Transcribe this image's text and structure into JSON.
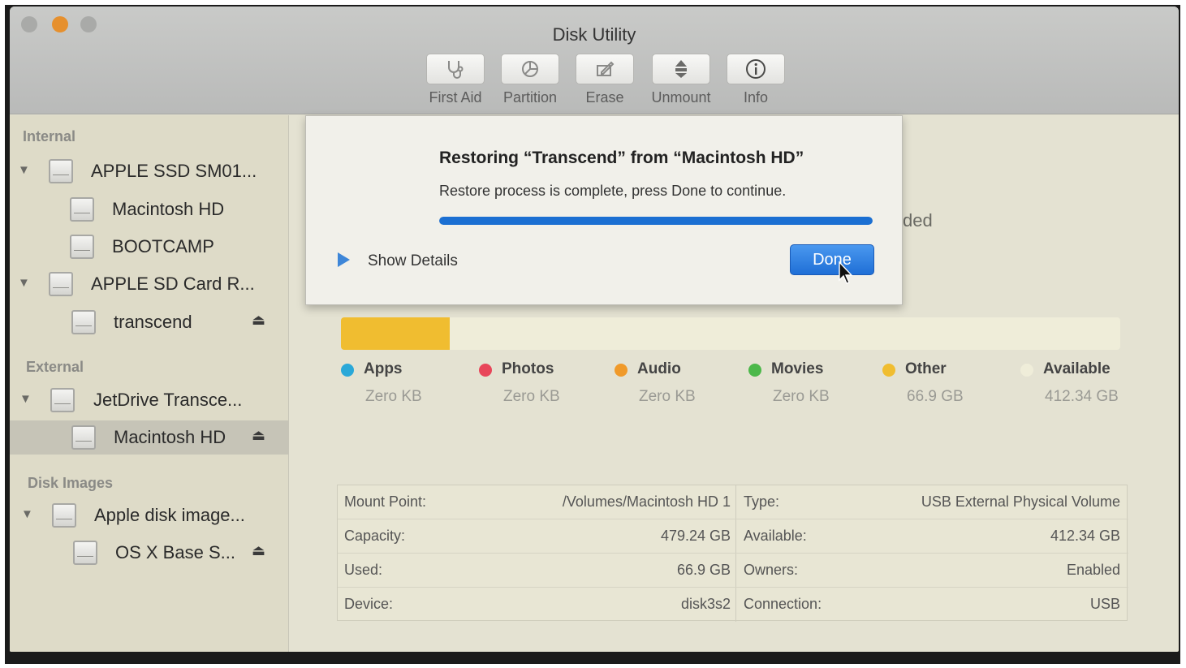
{
  "window": {
    "title": "Disk Utility"
  },
  "toolbar": {
    "items": [
      {
        "label": "First Aid",
        "icon": "stethoscope-icon"
      },
      {
        "label": "Partition",
        "icon": "partition-pie-icon"
      },
      {
        "label": "Erase",
        "icon": "erase-icon"
      },
      {
        "label": "Unmount",
        "icon": "unmount-icon"
      },
      {
        "label": "Info",
        "icon": "info-icon"
      }
    ]
  },
  "sidebar": {
    "sections": {
      "internal": "Internal",
      "external": "External",
      "disk_images": "Disk Images"
    },
    "items": [
      {
        "label": "APPLE SSD SM01..."
      },
      {
        "label": "Macintosh HD"
      },
      {
        "label": "BOOTCAMP"
      },
      {
        "label": "APPLE SD Card R..."
      },
      {
        "label": "transcend"
      },
      {
        "label": "JetDrive Transce..."
      },
      {
        "label": "Macintosh HD"
      },
      {
        "label": "Apple disk image..."
      },
      {
        "label": "OS X Base S..."
      }
    ],
    "selected_index": 6,
    "eject_symbol": "⏏"
  },
  "main": {
    "partial_text": "ded",
    "usage": {
      "used_fraction": 0.14
    },
    "legend": [
      {
        "name": "Apps",
        "value": "Zero KB",
        "color": "#2aa8d8"
      },
      {
        "name": "Photos",
        "value": "Zero KB",
        "color": "#e8465a"
      },
      {
        "name": "Audio",
        "value": "Zero KB",
        "color": "#f09a2a"
      },
      {
        "name": "Movies",
        "value": "Zero KB",
        "color": "#4cb84a"
      },
      {
        "name": "Other",
        "value": "66.9 GB",
        "color": "#f0bd30"
      },
      {
        "name": "Available",
        "value": "412.34 GB",
        "color": "#efedd9"
      }
    ],
    "info": {
      "left": [
        {
          "key": "Mount Point:",
          "value": "/Volumes/Macintosh HD 1"
        },
        {
          "key": "Capacity:",
          "value": "479.24 GB"
        },
        {
          "key": "Used:",
          "value": "66.9 GB"
        },
        {
          "key": "Device:",
          "value": "disk3s2"
        }
      ],
      "right": [
        {
          "key": "Type:",
          "value": "USB External Physical Volume"
        },
        {
          "key": "Available:",
          "value": "412.34 GB"
        },
        {
          "key": "Owners:",
          "value": "Enabled"
        },
        {
          "key": "Connection:",
          "value": "USB"
        }
      ]
    }
  },
  "dialog": {
    "title": "Restoring “Transcend” from “Macintosh HD”",
    "message": "Restore process is complete, press Done to continue.",
    "progress": 1.0,
    "show_details_label": "Show Details",
    "done_label": "Done",
    "accent": "#1f6fd6"
  }
}
